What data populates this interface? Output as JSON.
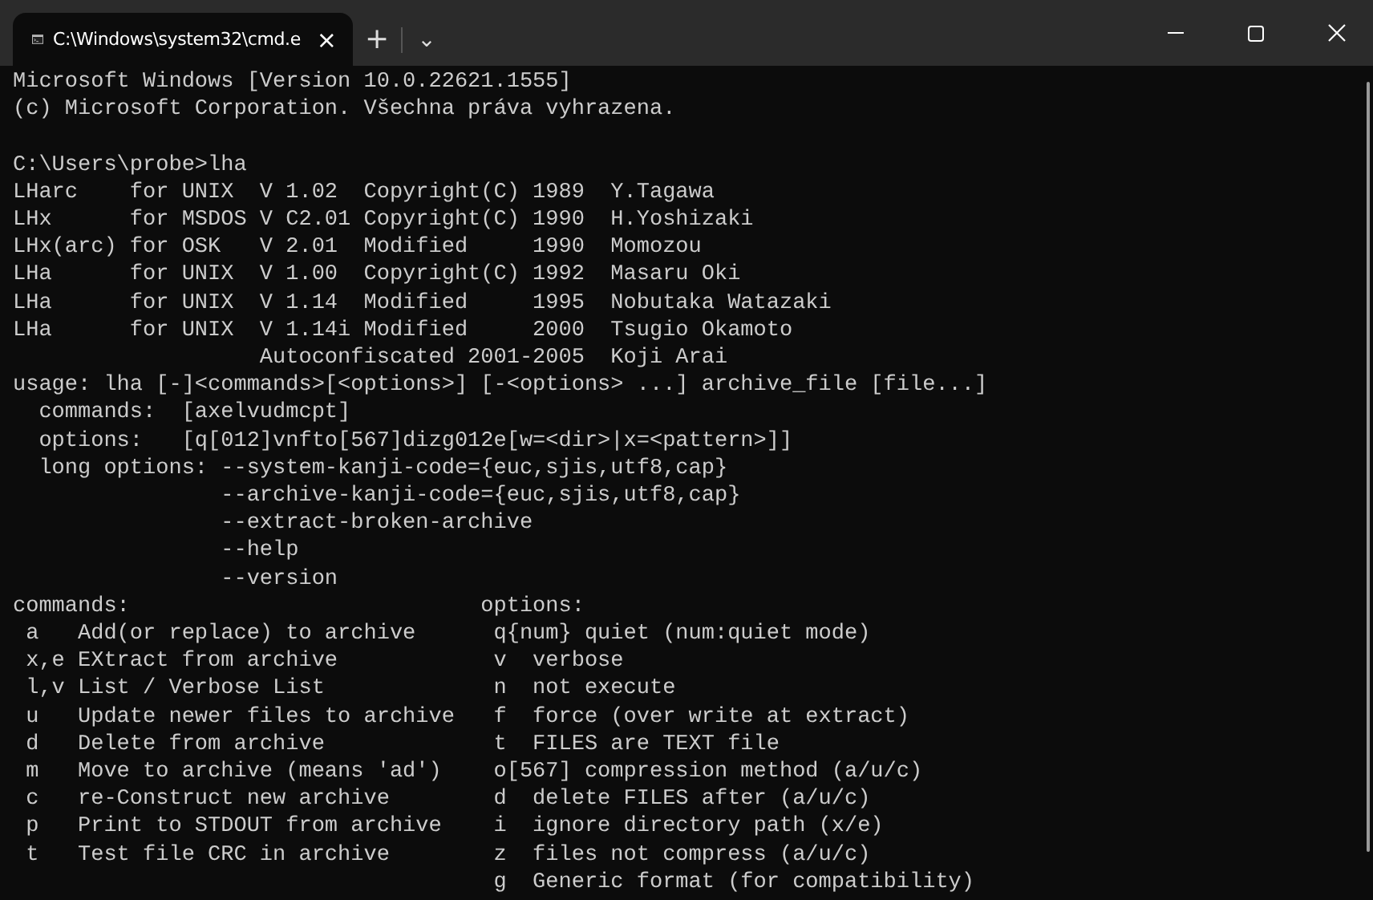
{
  "tabs": [
    {
      "title": "C:\\Windows\\system32\\cmd.e",
      "close": "×",
      "selected": true
    }
  ],
  "tab_bar": {
    "new_tab": "+",
    "dropdown": "⌄"
  },
  "terminal": {
    "blocks": [
      [
        "Microsoft Windows [Version 10.0.22621.1555]",
        "(c) Microsoft Corporation. Všechna práva vyhrazena."
      ],
      [
        "C:\\Users\\probe>lha",
        "LHarc    for UNIX  V 1.02  Copyright(C) 1989  Y.Tagawa",
        "LHx      for MSDOS V C2.01 Copyright(C) 1990  H.Yoshizaki",
        "LHx(arc) for OSK   V 2.01  Modified     1990  Momozou",
        "LHa      for UNIX  V 1.00  Copyright(C) 1992  Masaru Oki",
        "LHa      for UNIX  V 1.14  Modified     1995  Nobutaka Watazaki",
        "LHa      for UNIX  V 1.14i Modified     2000  Tsugio Okamoto",
        "                   Autoconfiscated 2001-2005  Koji Arai",
        "usage: lha [-]<commands>[<options>] [-<options> ...] archive_file [file...]",
        "  commands:  [axelvudmcpt]",
        "  options:   [q[012]vnfto[567]dizg012e[w=<dir>|x=<pattern>]]",
        "  long options: --system-kanji-code={euc,sjis,utf8,cap}",
        "                --archive-kanji-code={euc,sjis,utf8,cap}",
        "                --extract-broken-archive",
        "                --help",
        "                --version",
        "commands:                           options:",
        " a   Add(or replace) to archive      q{num} quiet (num:quiet mode)",
        " x,e EXtract from archive            v  verbose",
        " l,v List / Verbose List             n  not execute",
        " u   Update newer files to archive   f  force (over write at extract)",
        " d   Delete from archive             t  FILES are TEXT file",
        " m   Move to archive (means 'ad')    o[567] compression method (a/u/c)",
        " c   re-Construct new archive        d  delete FILES after (a/u/c)",
        " p   Print to STDOUT from archive    i  ignore directory path (x/e)",
        " t   Test file CRC in archive        z  files not compress (a/u/c)",
        "                                     g  Generic format (for compatibility)"
      ]
    ]
  }
}
